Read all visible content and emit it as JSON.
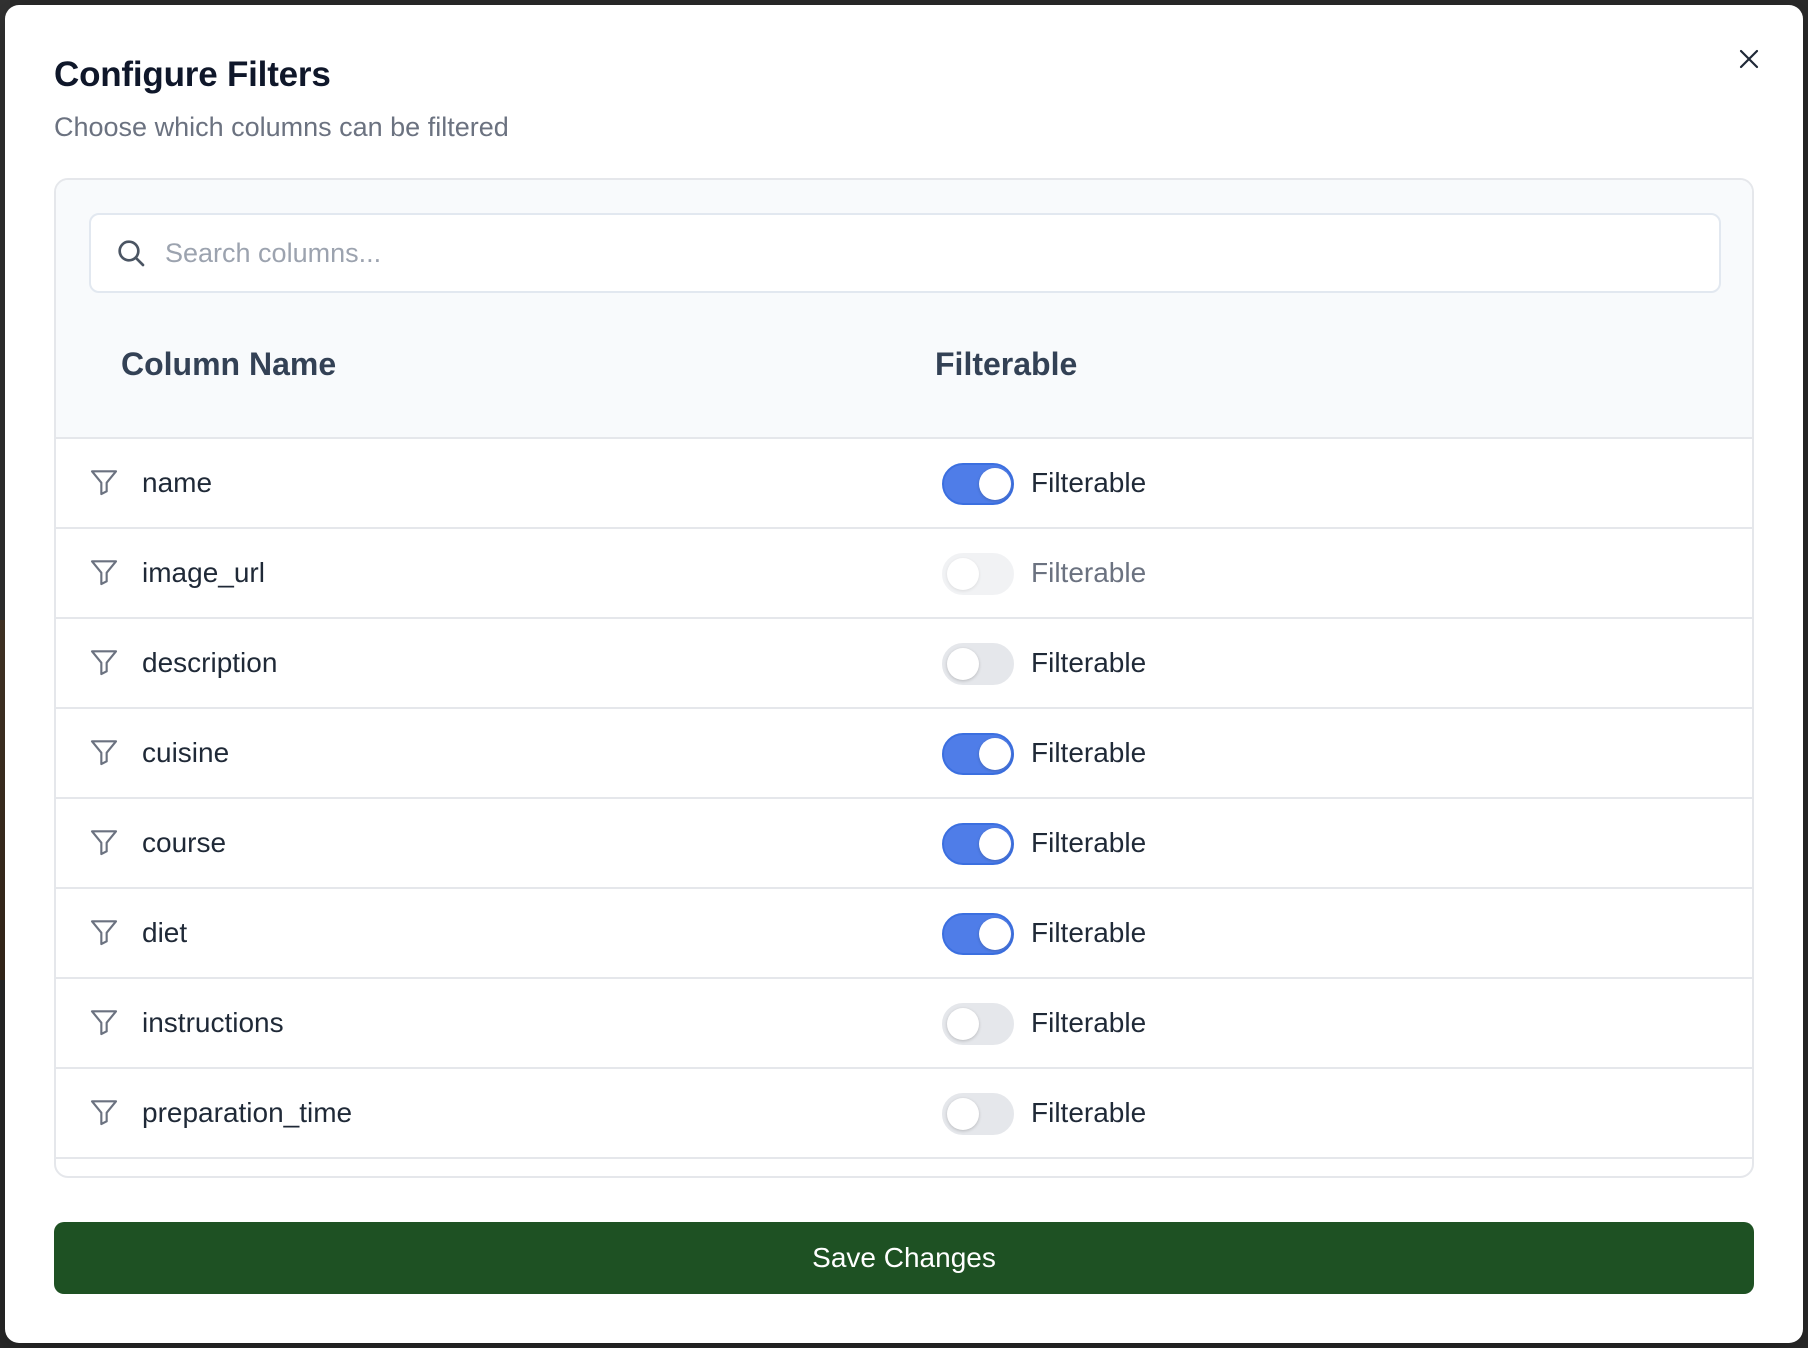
{
  "dialog": {
    "title": "Configure Filters",
    "subtitle": "Choose which columns can be filtered",
    "close_icon": "close-icon"
  },
  "search": {
    "placeholder": "Search columns...",
    "value": "",
    "icon": "search-icon"
  },
  "table": {
    "headers": [
      "Column Name",
      "Filterable"
    ],
    "rows": [
      {
        "name": "name",
        "filterable": true,
        "disabled": false,
        "label": "Filterable"
      },
      {
        "name": "image_url",
        "filterable": false,
        "disabled": true,
        "label": "Filterable"
      },
      {
        "name": "description",
        "filterable": false,
        "disabled": false,
        "label": "Filterable"
      },
      {
        "name": "cuisine",
        "filterable": true,
        "disabled": false,
        "label": "Filterable"
      },
      {
        "name": "course",
        "filterable": true,
        "disabled": false,
        "label": "Filterable"
      },
      {
        "name": "diet",
        "filterable": true,
        "disabled": false,
        "label": "Filterable"
      },
      {
        "name": "instructions",
        "filterable": false,
        "disabled": false,
        "label": "Filterable"
      },
      {
        "name": "preparation_time",
        "filterable": false,
        "disabled": false,
        "label": "Filterable"
      }
    ]
  },
  "footer": {
    "save_label": "Save Changes"
  },
  "colors": {
    "toggle_on": "#4f7de8",
    "toggle_off": "#e5e7eb",
    "save_button": "#1e5123"
  }
}
